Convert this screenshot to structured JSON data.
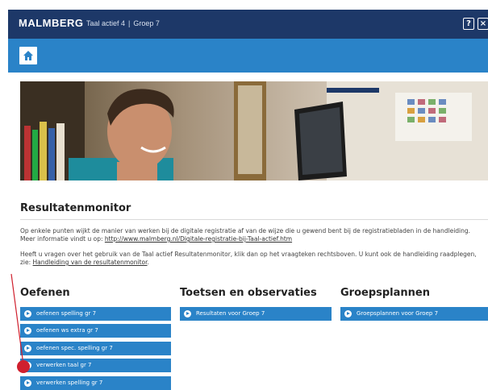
{
  "header": {
    "logo": "MALMBERG",
    "app_name": "Taal actief 4",
    "separator": "|",
    "group": "Groep 7",
    "help_label": "?",
    "close_label": "×"
  },
  "nav": {
    "home_icon": "home-icon"
  },
  "page": {
    "title": "Resultatenmonitor",
    "para1_line1": "Op enkele punten wijkt de manier van werken bij de digitale registratie af van de wijze die u gewend bent bij de registratiebladen in de handleiding.",
    "para1_line2_prefix": "Meer informatie vindt u op: ",
    "para1_link": "http://www.malmberg.nl/Digitale-registratie-bij-Taal-actief.htm",
    "para2_line1": "Heeft u vragen over het gebruik van de Taal actief Resultatenmonitor, klik dan op het vraagteken rechtsboven. U kunt ook de handleiding raadplegen,",
    "para2_line2_prefix": "zie: ",
    "para2_link": "Handleiding van de resultatenmonitor",
    "para2_suffix": "."
  },
  "columns": {
    "oefenen": {
      "heading": "Oefenen",
      "buttons": [
        "oefenen spelling gr 7",
        "oefenen ws extra gr 7",
        "oefenen spec. spelling gr 7",
        "verwerken taal gr 7",
        "verwerken spelling gr 7"
      ]
    },
    "toetsen": {
      "heading": "Toetsen en observaties",
      "buttons": [
        "Resultaten voor Groep 7"
      ]
    },
    "groepsplannen": {
      "heading": "Groepsplannen",
      "buttons": [
        "Groepsplannen voor Groep 7"
      ]
    }
  },
  "colors": {
    "header_bg": "#1d3868",
    "accent": "#2a83c8",
    "pointer": "#d0202e"
  }
}
